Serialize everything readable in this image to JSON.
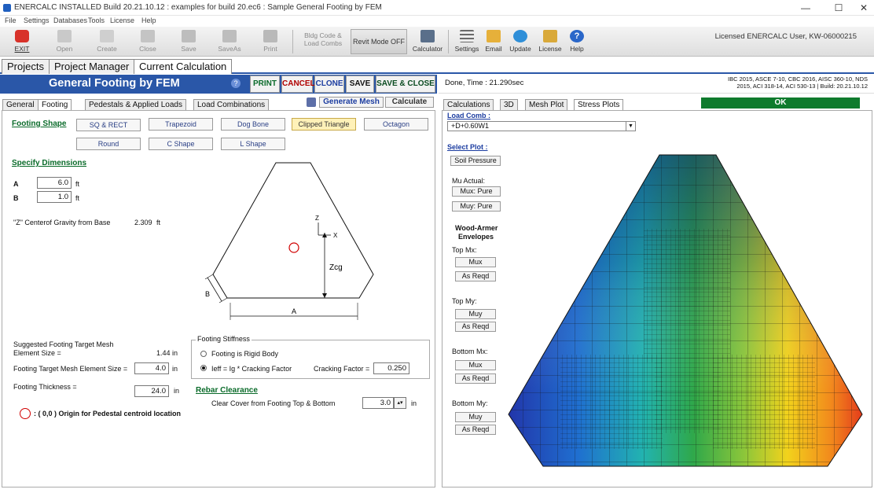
{
  "window": {
    "title": "ENERCALC INSTALLED Build 20.21.10.12 :  examples for build 20.ec6 : Sample General Footing by FEM",
    "minimize": "—",
    "maximize": "☐",
    "close": "✕"
  },
  "menu": [
    "File",
    "Settings",
    "Databases",
    "Tools",
    "License",
    "Help"
  ],
  "toolbar": {
    "exit": "EXIT",
    "open": "Open",
    "create": "Create",
    "close": "Close",
    "save": "Save",
    "saveas": "SaveAs",
    "print": "Print",
    "bldg_code": "Bldg Code & Load Combs",
    "revit": "Revit Mode OFF",
    "calculator": "Calculator",
    "settings": "Settings",
    "email": "Email",
    "update": "Update",
    "license": "License",
    "help": "Help",
    "licensed": "Licensed ENERCALC User, KW-06000215"
  },
  "main_tabs": [
    "Projects",
    "Project Manager",
    "Current Calculation"
  ],
  "header": {
    "title": "General Footing by FEM",
    "help": "?",
    "print": "PRINT",
    "cancel": "CANCEL",
    "clone": "CLONE",
    "save": "SAVE",
    "save_close": "SAVE & CLOSE",
    "done_time": "Done, Time :  21.290sec",
    "codes_line1": "IBC 2015, ASCE 7-10, CBC 2016, AISC 360-10, NDS",
    "codes_line2": "2015, ACI 318-14, ACI 530-13 | Build: 20.21.10.12"
  },
  "left_tabs": [
    "General",
    "Footing",
    "Pedestals & Applied Loads",
    "Load Combinations"
  ],
  "generate_mesh": "Generate Mesh",
  "calculate": "Calculate",
  "footing_shape": {
    "title": "Footing Shape",
    "buttons": [
      "SQ & RECT",
      "Trapezoid",
      "Dog Bone",
      "Clipped Triangle",
      "Octagon",
      "Round",
      "C Shape",
      "L Shape"
    ]
  },
  "dimensions": {
    "title": "Specify Dimensions",
    "a_label": "A",
    "a_value": "6.0",
    "a_unit": "ft",
    "b_label": "B",
    "b_value": "1.0",
    "b_unit": "ft",
    "cg_label": "\"Z\" Centerof Gravity from Base",
    "cg_value": "2.309",
    "cg_unit": "ft"
  },
  "diagram": {
    "z": "Z",
    "x": "X",
    "zcg": "Zcg",
    "a": "A",
    "b": "B"
  },
  "mesh": {
    "suggested_line1": "Suggested Footing Target Mesh",
    "suggested_line2": "Element Size =",
    "suggested_value": "1.44 in",
    "target_label": "Footing Target Mesh Element Size =",
    "target_value": "4.0",
    "target_unit": "in",
    "thickness_label": "Footing Thickness =",
    "thickness_value": "24.0",
    "thickness_unit": "in"
  },
  "stiffness": {
    "title": "Footing Stiffness",
    "opt1": "Footing is Rigid Body",
    "opt2": "Ieff = Ig * Cracking Factor",
    "cracking_label": "Cracking Factor =",
    "cracking_value": "0.250"
  },
  "rebar": {
    "title": "Rebar Clearance",
    "cover_label": "Clear Cover from Footing Top & Bottom",
    "cover_value": "3.0",
    "cover_unit": "in"
  },
  "origin_note": ": ( 0,0 ) Origin for Pedestal centroid location",
  "right_tabs": [
    "Calculations",
    "3D",
    "Mesh Plot",
    "Stress Plots"
  ],
  "ok": "OK",
  "stress": {
    "load_comb_label": "Load Comb :",
    "load_comb_value": "+D+0.60W1",
    "select_plot": "Select Plot :",
    "soil_pressure": "Soil Pressure",
    "mu_actual": "Mu Actual:",
    "mux_pure": "Mux: Pure",
    "muy_pure": "Muy: Pure",
    "wood_armer_1": "Wood-Armer",
    "wood_armer_2": "Envelopes",
    "top_mx": "Top Mx:",
    "top_my": "Top My:",
    "bottom_mx": "Bottom Mx:",
    "bottom_my": "Bottom My:",
    "mux": "Mux",
    "muy": "Muy",
    "as_reqd": "As Reqd"
  },
  "colors": {
    "blue_header": "#2a57a8",
    "green_title": "#0a6b2a",
    "ok_green": "#0f7b2d",
    "cancel_red": "#b00000"
  }
}
